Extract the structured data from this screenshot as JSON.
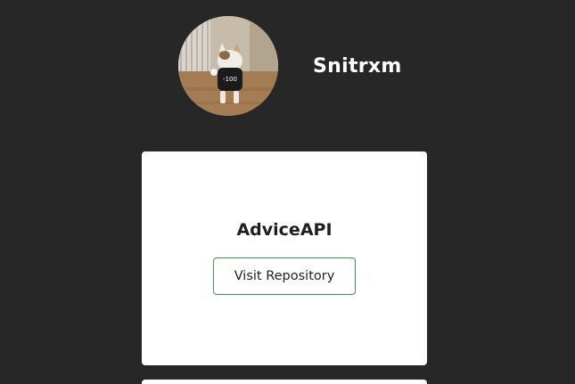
{
  "profile": {
    "username": "Snitrxm",
    "avatar_icon": "cat-photo"
  },
  "cards": [
    {
      "title": "AdviceAPI",
      "button_label": "Visit Repository"
    }
  ],
  "colors": {
    "background": "#272727",
    "card": "#ffffff",
    "button_border": "#3a9a4a"
  }
}
